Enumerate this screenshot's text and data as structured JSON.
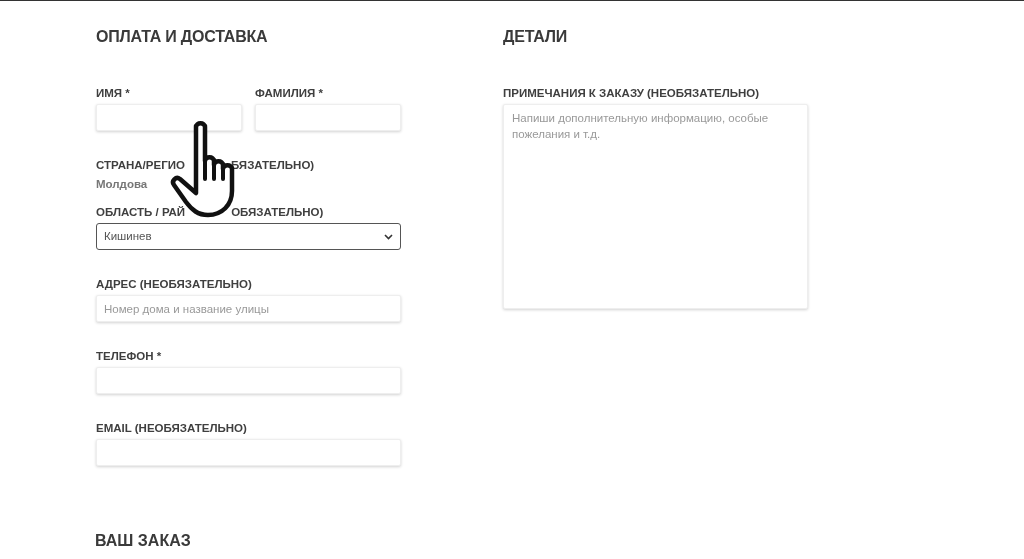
{
  "left": {
    "heading": "ОПЛАТА И ДОСТАВКА",
    "rows": [
      {
        "fields": [
          {
            "kind": "input",
            "label": "ИМЯ *"
          },
          {
            "kind": "input",
            "label": "ФАМИЛИЯ *"
          }
        ]
      },
      {
        "fields": [
          {
            "kind": "static",
            "label_parts": [
              "СТРАНА/РЕГИО",
              "БЯЗАТЕЛЬНО)"
            ],
            "value": "Молдова"
          }
        ]
      },
      {
        "fields": [
          {
            "kind": "select",
            "label_parts": [
              "ОБЛАСТЬ / РАЙ",
              "ОБЯЗАТЕЛЬНО)"
            ],
            "value": "Кишинев"
          }
        ]
      },
      {
        "fields": [
          {
            "kind": "input",
            "label": "АДРЕС (НЕОБЯЗАТЕЛЬНО)",
            "placeholder": "Номер дома и название улицы"
          }
        ]
      },
      {
        "fields": [
          {
            "kind": "input",
            "label": "ТЕЛЕФОН *"
          }
        ]
      },
      {
        "fields": [
          {
            "kind": "input",
            "label": "EMAIL (НЕОБЯЗАТЕЛЬНО)"
          }
        ]
      }
    ]
  },
  "right": {
    "heading": "ДЕТАЛИ",
    "fields": [
      {
        "kind": "textarea",
        "label": "ПРИМЕЧАНИЯ К ЗАКАЗУ (НЕОБЯЗАТЕЛЬНО)",
        "placeholder": "Напиши дополнительную информацию, особые пожелания и т.д."
      }
    ]
  },
  "order_heading": "ВАШ ЗАКАЗ"
}
